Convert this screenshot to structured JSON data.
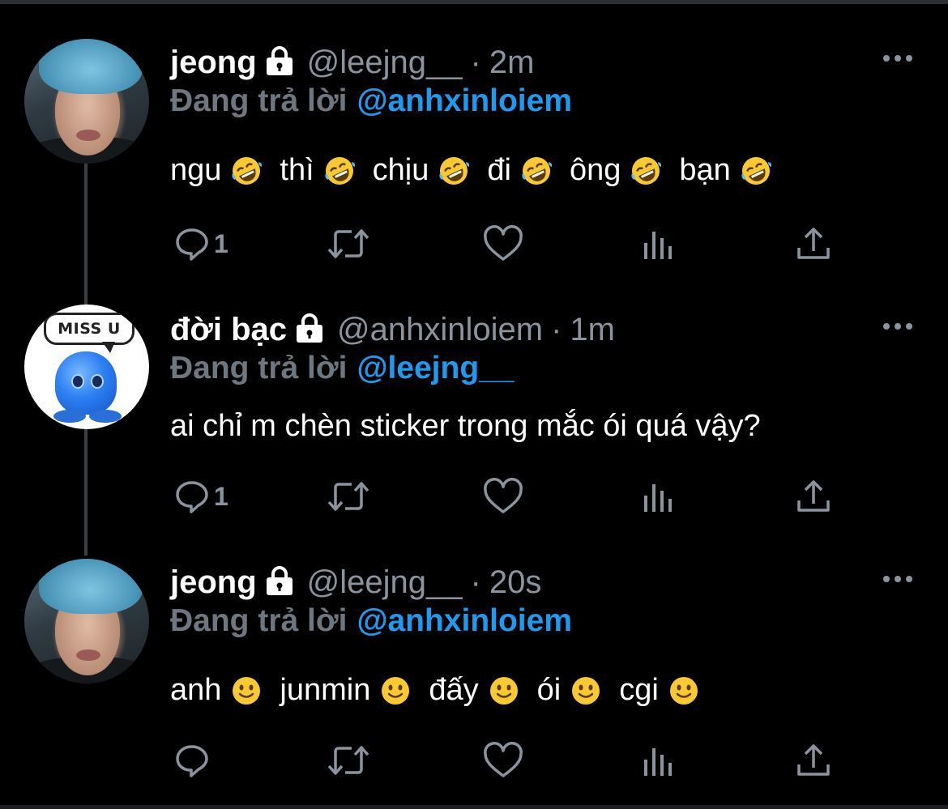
{
  "colors": {
    "background": "#000000",
    "muted": "#8b949e",
    "reply_prefix": "#6e7780",
    "mention": "#1d9bf0",
    "thread_line": "#3a3f44"
  },
  "tweets": [
    {
      "name": "jeong",
      "handle": "@leejng__",
      "separator": "·",
      "time": "2m",
      "reply_prefix": "Đang trả lời",
      "reply_to": "@anhxinloiem",
      "content_words": [
        "ngu",
        "thì",
        "chịu",
        "đi",
        "ông",
        "bạn"
      ],
      "content_emoji": "rolling-on-floor-laughing-emoji",
      "avatar": "user-photo-avatar",
      "reply_count": "1"
    },
    {
      "name": "đời bạc",
      "handle": "@anhxinloiem",
      "separator": "·",
      "time": "1m",
      "reply_prefix": "Đang trả lời",
      "reply_to": "@leejng__",
      "content": "ai chỉ m chèn sticker trong mắc ói quá vậy?",
      "avatar": "miss-u-sticker-avatar",
      "avatar_text": "MISS U",
      "reply_count": "1"
    },
    {
      "name": "jeong",
      "handle": "@leejng__",
      "separator": "·",
      "time": "20s",
      "reply_prefix": "Đang trả lời",
      "reply_to": "@anhxinloiem",
      "content_words": [
        "anh",
        "junmin",
        "đấy",
        "ói",
        "cgi"
      ],
      "content_emoji": "slightly-smiling-face-emoji",
      "avatar": "user-photo-avatar",
      "reply_count": ""
    }
  ],
  "action_icons": [
    "reply-icon",
    "retweet-icon",
    "like-icon",
    "views-icon",
    "share-icon"
  ],
  "more_icon": "more-options-icon"
}
